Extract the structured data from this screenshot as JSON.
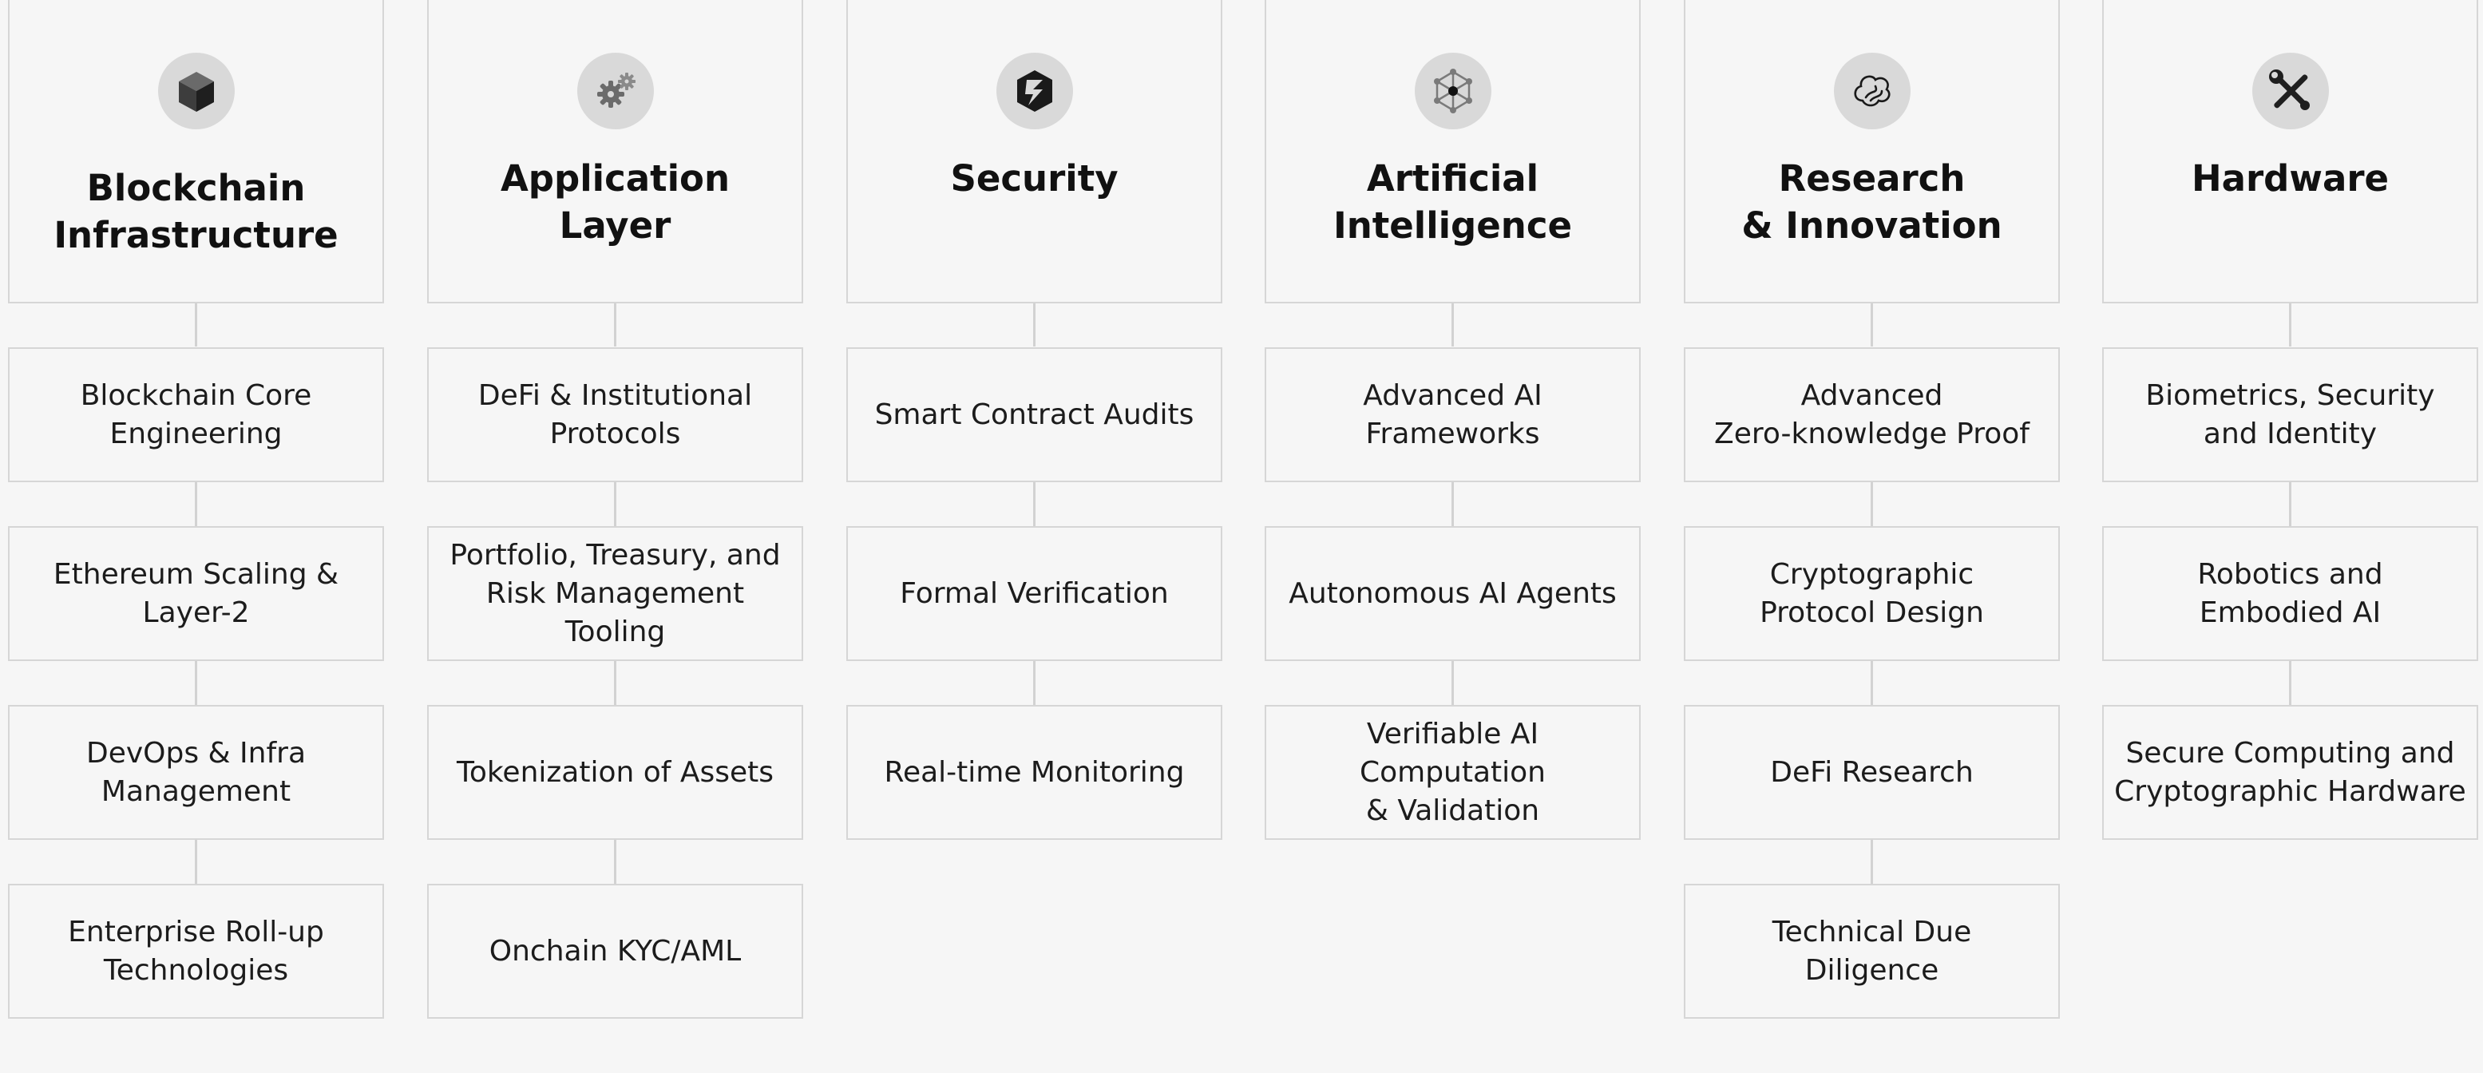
{
  "columns": [
    {
      "id": "blockchain",
      "icon": "cube-icon",
      "title_lines": [
        "Blockchain",
        "Infrastructure"
      ],
      "items": [
        [
          "Blockchain Core",
          "Engineering"
        ],
        [
          "Ethereum Scaling &",
          "Layer-2"
        ],
        [
          "DevOps & Infra",
          "Management"
        ],
        [
          "Enterprise Roll-up",
          "Technologies"
        ]
      ]
    },
    {
      "id": "application",
      "icon": "gears-icon",
      "title_lines": [
        "Application",
        "Layer"
      ],
      "items": [
        [
          "DeFi & Institutional",
          "Protocols"
        ],
        [
          "Portfolio, Treasury, and",
          "Risk Management Tooling"
        ],
        [
          "Tokenization of Assets"
        ],
        [
          "Onchain KYC/AML"
        ]
      ]
    },
    {
      "id": "security",
      "icon": "shield-bolt-icon",
      "title_lines": [
        "Security"
      ],
      "items": [
        [
          "Smart Contract Audits"
        ],
        [
          "Formal Verification"
        ],
        [
          "Real-time Monitoring"
        ]
      ]
    },
    {
      "id": "ai",
      "icon": "network-icon",
      "title_lines": [
        "Artificial",
        "Intelligence"
      ],
      "items": [
        [
          "Advanced AI",
          "Frameworks"
        ],
        [
          "Autonomous AI Agents"
        ],
        [
          "Verifiable AI Computation",
          "& Validation"
        ]
      ]
    },
    {
      "id": "research",
      "icon": "brain-icon",
      "title_lines": [
        "Research",
        "& Innovation"
      ],
      "items": [
        [
          "Advanced",
          "Zero-knowledge Proof"
        ],
        [
          "Cryptographic",
          "Protocol Design"
        ],
        [
          "DeFi Research"
        ],
        [
          "Technical Due",
          "Diligence"
        ]
      ]
    },
    {
      "id": "hardware",
      "icon": "tools-icon",
      "title_lines": [
        "Hardware"
      ],
      "items": [
        [
          "Biometrics, Security",
          "and Identity"
        ],
        [
          "Robotics and",
          "Embodied AI"
        ],
        [
          "Secure Computing and",
          "Cryptographic Hardware"
        ]
      ]
    }
  ],
  "colors": {
    "background": "#f6f6f6",
    "border": "#d6d6d6",
    "connector": "#d2d2d2",
    "icon_circle": "#d9d9d9",
    "text": "#111111"
  }
}
